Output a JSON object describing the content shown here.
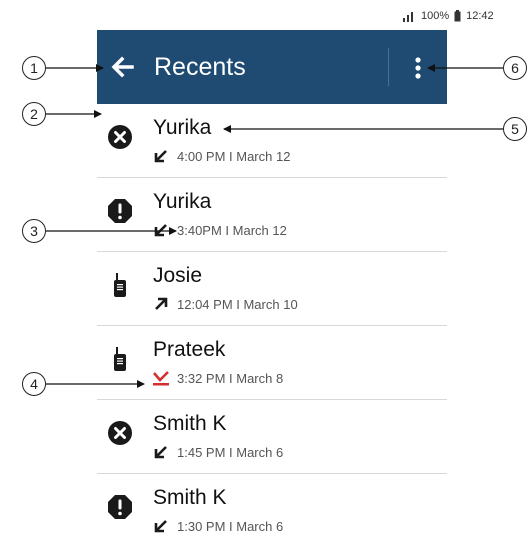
{
  "status_bar": {
    "text": "100%",
    "time": "12:42"
  },
  "app_bar": {
    "title": "Recents"
  },
  "callouts": [
    "1",
    "2",
    "3",
    "4",
    "5",
    "6"
  ],
  "colors": {
    "app_bar_bg": "#1f4a72",
    "missed_underline": "#d32f2f"
  },
  "recents": [
    {
      "name": "Yurika",
      "status_icon": "close-circle-icon",
      "direction_icon": "incoming-arrow-icon",
      "when": "4:00 PM I March 12"
    },
    {
      "name": "Yurika",
      "status_icon": "exclamation-icon",
      "direction_icon": "incoming-arrow-icon",
      "when": "3:40PM I March 12"
    },
    {
      "name": "Josie",
      "status_icon": "radio-device-icon",
      "direction_icon": "outgoing-arrow-icon",
      "when": "12:04 PM I March 10"
    },
    {
      "name": "Prateek",
      "status_icon": "radio-device-icon",
      "direction_icon": "missed-call-icon",
      "when": "3:32 PM I March 8"
    },
    {
      "name": "Smith K",
      "status_icon": "close-circle-icon",
      "direction_icon": "incoming-arrow-icon",
      "when": "1:45 PM I March 6"
    },
    {
      "name": "Smith K",
      "status_icon": "exclamation-icon",
      "direction_icon": "incoming-arrow-icon",
      "when": "1:30 PM I March 6"
    }
  ]
}
